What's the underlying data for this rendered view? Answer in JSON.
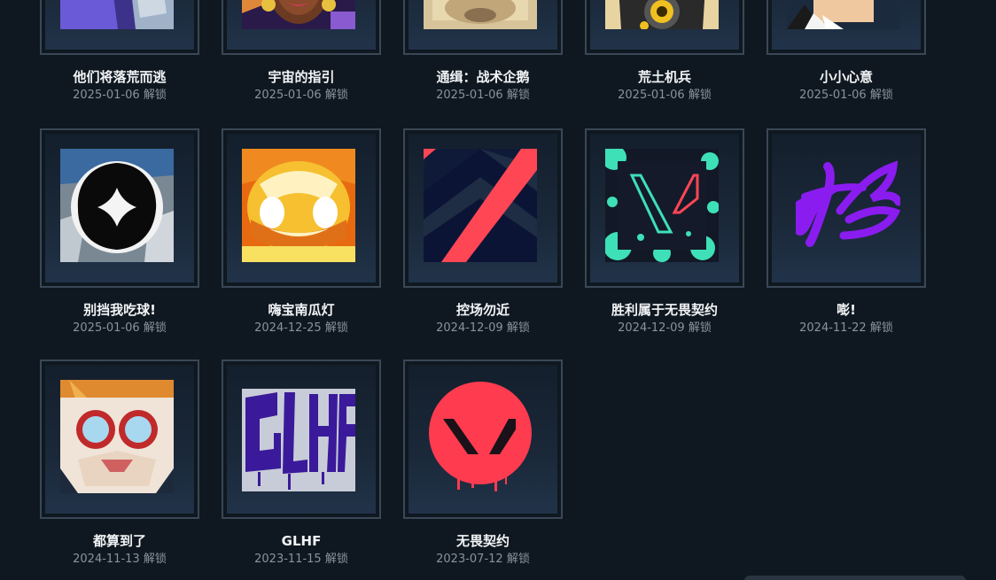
{
  "unlock_label": "解锁",
  "cards": [
    {
      "title": "他们将落荒而逃",
      "date": "2025-01-06",
      "icon": "purple-character-icon"
    },
    {
      "title": "宇宙的指引",
      "date": "2025-01-06",
      "icon": "astra-portrait-icon"
    },
    {
      "title": "通缉：战术企鹅",
      "date": "2025-01-06",
      "icon": "penguin-wanted-icon"
    },
    {
      "title": "荒土机兵",
      "date": "2025-01-06",
      "icon": "wasteland-robot-icon"
    },
    {
      "title": "小小心意",
      "date": "2025-01-06",
      "icon": "suited-man-icon"
    },
    {
      "title": "别挡我吃球!",
      "date": "2025-01-06",
      "icon": "black-spike-icon"
    },
    {
      "title": "嗨宝南瓜灯",
      "date": "2024-12-25",
      "icon": "pumpkin-lantern-icon"
    },
    {
      "title": "控场勿近",
      "date": "2024-12-09",
      "icon": "control-chevron-icon"
    },
    {
      "title": "胜利属于无畏契约",
      "date": "2024-12-09",
      "icon": "valorant-splatter-icon"
    },
    {
      "title": "嘭!",
      "date": "2024-11-22",
      "icon": "purple-graffiti-icon"
    },
    {
      "title": "都算到了",
      "date": "2024-11-13",
      "icon": "goggles-character-icon"
    },
    {
      "title": "GLHF",
      "date": "2023-11-15",
      "icon": "glhf-graffiti-icon"
    },
    {
      "title": "无畏契约",
      "date": "2023-07-12",
      "icon": "valorant-logo-icon"
    }
  ]
}
